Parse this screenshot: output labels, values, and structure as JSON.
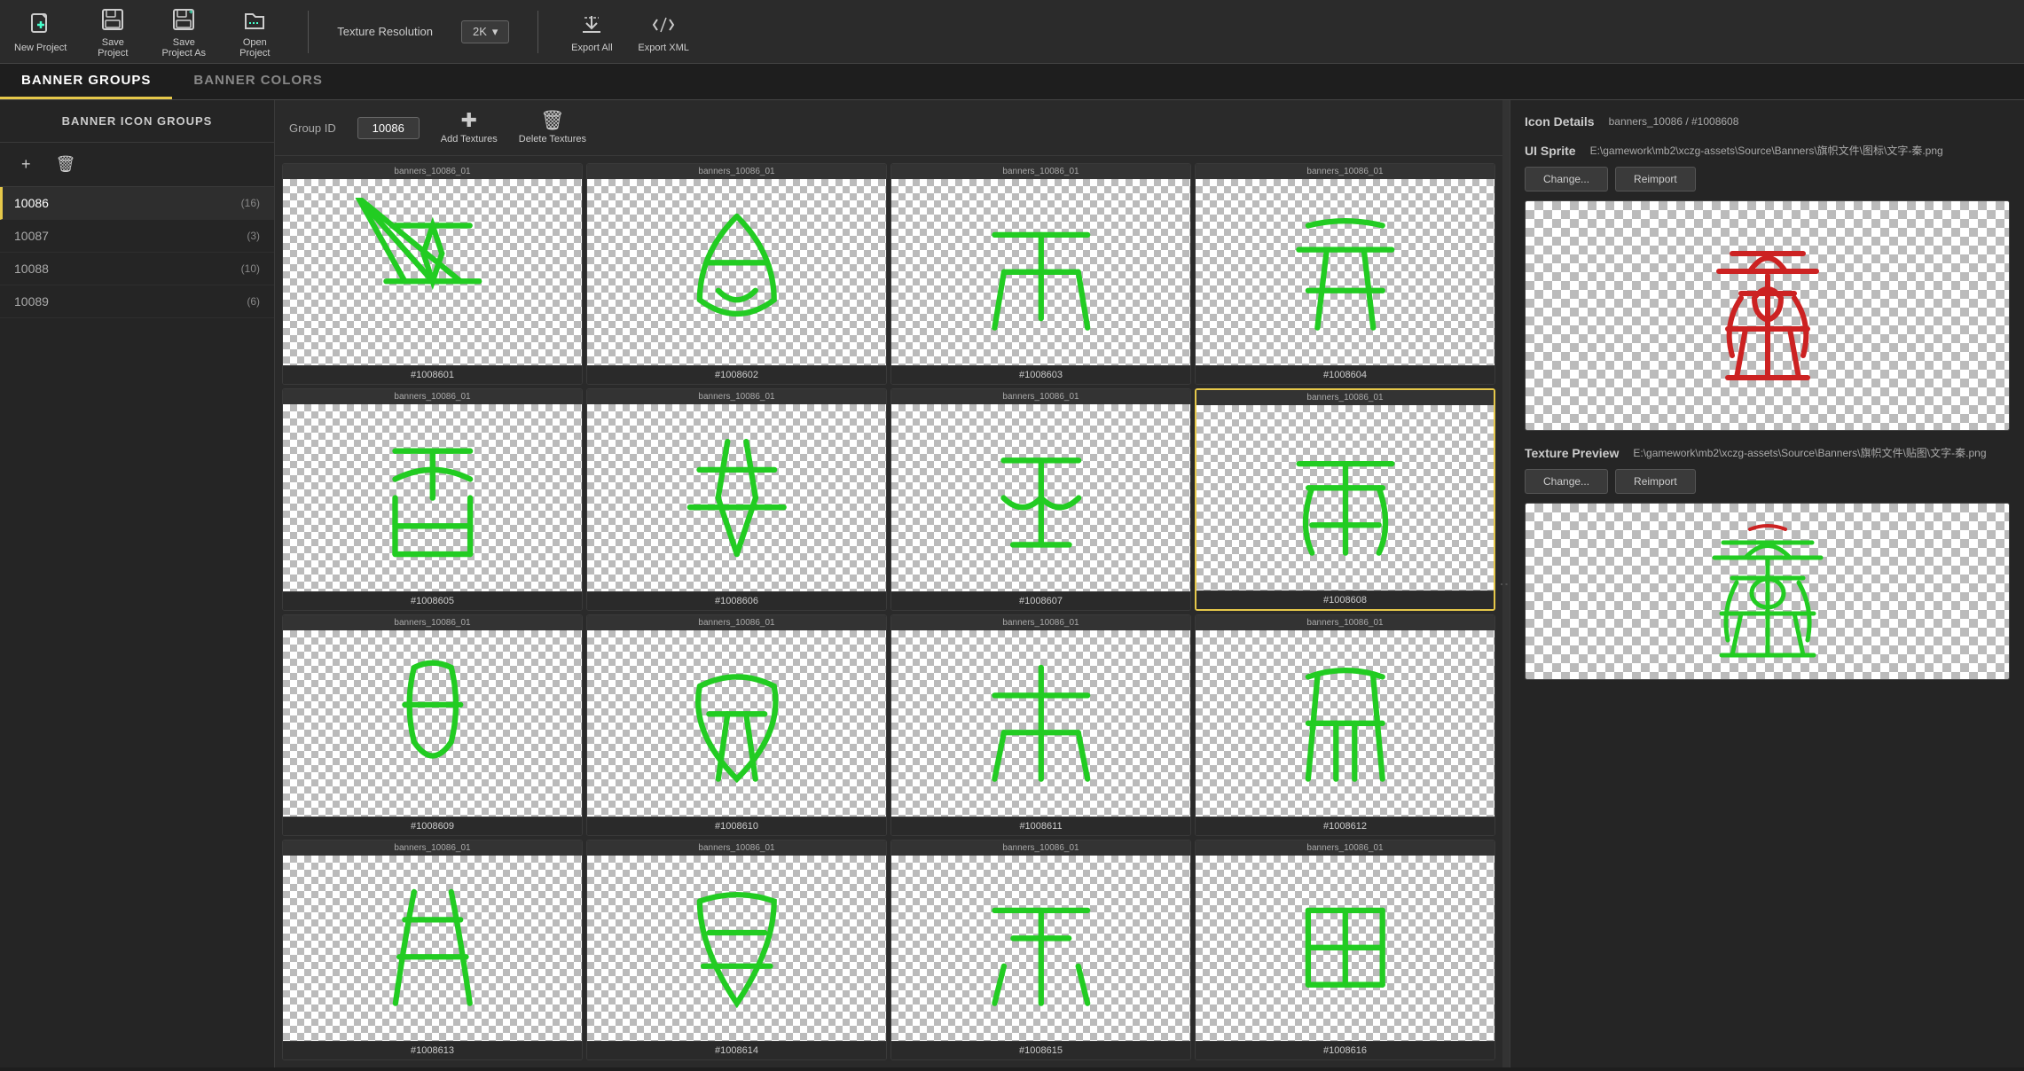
{
  "toolbar": {
    "new_project_label": "New Project",
    "save_project_label": "Save\nProject",
    "save_as_label": "Save\nProject As",
    "open_project_label": "Open\nProject",
    "texture_resolution_label": "Texture Resolution",
    "resolution_value": "2K",
    "export_all_label": "Export All",
    "export_xml_label": "Export XML"
  },
  "tabs": [
    {
      "id": "banner-groups",
      "label": "BANNER GROUPS",
      "active": true
    },
    {
      "id": "banner-colors",
      "label": "BANNER COLORS",
      "active": false
    }
  ],
  "sidebar": {
    "title": "BANNER ICON GROUPS",
    "add_icon": "+",
    "delete_icon": "🗑",
    "groups": [
      {
        "id": "10086",
        "count": 16,
        "active": true
      },
      {
        "id": "10087",
        "count": 3,
        "active": false
      },
      {
        "id": "10088",
        "count": 10,
        "active": false
      },
      {
        "id": "10089",
        "count": 6,
        "active": false
      }
    ]
  },
  "group_toolbar": {
    "group_id_label": "Group ID",
    "group_id_value": "10086",
    "add_textures_label": "Add Textures",
    "delete_textures_label": "Delete Textures"
  },
  "icons": [
    {
      "id": "#1008601",
      "source": "banners_10086_01",
      "selected": false
    },
    {
      "id": "#1008602",
      "source": "banners_10086_01",
      "selected": false
    },
    {
      "id": "#1008603",
      "source": "banners_10086_01",
      "selected": false
    },
    {
      "id": "#1008604",
      "source": "banners_10086_01",
      "selected": false
    },
    {
      "id": "#1008605",
      "source": "banners_10086_01",
      "selected": false
    },
    {
      "id": "#1008606",
      "source": "banners_10086_01",
      "selected": false
    },
    {
      "id": "#1008607",
      "source": "banners_10086_01",
      "selected": false
    },
    {
      "id": "#1008608",
      "source": "banners_10086_01",
      "selected": true
    },
    {
      "id": "#1008609",
      "source": "banners_10086_01",
      "selected": false
    },
    {
      "id": "#1008610",
      "source": "banners_10086_01",
      "selected": false
    },
    {
      "id": "#1008611",
      "source": "banners_10086_01",
      "selected": false
    },
    {
      "id": "#1008612",
      "source": "banners_10086_01",
      "selected": false
    },
    {
      "id": "#1008613",
      "source": "banners_10086_01",
      "selected": false
    },
    {
      "id": "#1008614",
      "source": "banners_10086_01",
      "selected": false
    },
    {
      "id": "#1008615",
      "source": "banners_10086_01",
      "selected": false
    },
    {
      "id": "#1008616",
      "source": "banners_10086_01",
      "selected": false
    }
  ],
  "right_panel": {
    "icon_details_title": "Icon Details",
    "icon_details_path": "banners_10086 / #1008608",
    "ui_sprite_title": "UI Sprite",
    "ui_sprite_path": "E:\\gamework\\mb2\\xczg-assets\\Source\\Banners\\旗帜文件\\图标\\文字-秦.png",
    "change_btn_label": "Change...",
    "reimport_btn_label": "Reimport",
    "texture_preview_title": "Texture Preview",
    "texture_preview_path": "E:\\gamework\\mb2\\xczg-assets\\Source\\Banners\\旗帜文件\\贴图\\文字-秦.png",
    "change_btn2_label": "Change...",
    "reimport_btn2_label": "Reimport"
  }
}
